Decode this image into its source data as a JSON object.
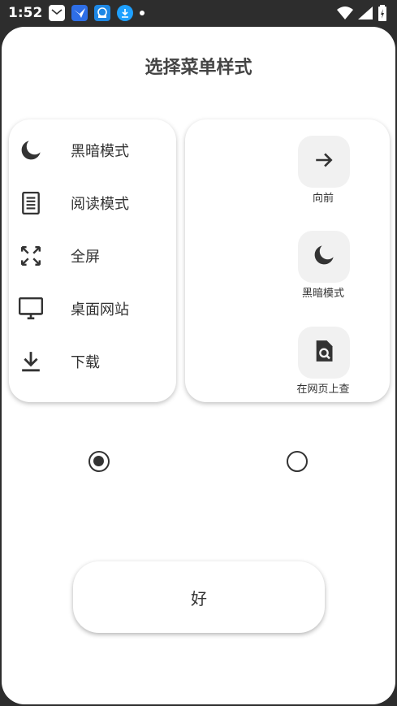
{
  "status_bar": {
    "time": "1:52"
  },
  "dialog": {
    "title": "选择菜单样式",
    "list_style": {
      "items": [
        {
          "icon": "moon-icon",
          "label": "黑暗模式"
        },
        {
          "icon": "reader-icon",
          "label": "阅读模式"
        },
        {
          "icon": "fullscreen-icon",
          "label": "全屏"
        },
        {
          "icon": "desktop-icon",
          "label": "桌面网站"
        },
        {
          "icon": "download-icon",
          "label": "下载"
        }
      ]
    },
    "grid_style": {
      "items": [
        {
          "icon": "arrow-forward-icon",
          "label": "向前"
        },
        {
          "icon": "moon-icon",
          "label": "黑暗模式"
        },
        {
          "icon": "find-in-page-icon",
          "label": "在网页上查"
        }
      ]
    },
    "selected_option": "list",
    "ok_label": "好"
  }
}
